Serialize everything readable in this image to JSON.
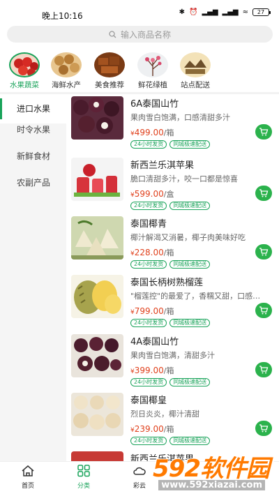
{
  "status_bar": {
    "time": "晚上10:16",
    "battery": "27"
  },
  "search": {
    "placeholder": "输入商品名称"
  },
  "categories": [
    {
      "label": "水果蔬菜",
      "selected": true
    },
    {
      "label": "海鲜水产",
      "selected": false
    },
    {
      "label": "美食推荐",
      "selected": false
    },
    {
      "label": "鲜花绿植",
      "selected": false
    },
    {
      "label": "站点配送",
      "selected": false
    }
  ],
  "sidebar": {
    "items": [
      {
        "label": "进口水果",
        "active": true
      },
      {
        "label": "时令水果",
        "active": false
      },
      {
        "label": "新鲜食材",
        "active": false
      },
      {
        "label": "农副产品",
        "active": false
      }
    ]
  },
  "products": [
    {
      "name": "6A泰国山竹",
      "desc": "果肉雪白饱满，口感清甜多汁",
      "currency": "¥",
      "price": "499.00",
      "unit": "/箱",
      "tags": [
        "24小时发货",
        "同城极速配送"
      ]
    },
    {
      "name": "新西兰乐淇苹果",
      "desc": "脆口清甜多汁，咬一口都是惊喜",
      "currency": "¥",
      "price": "599.00",
      "unit": "/盒",
      "tags": [
        "24小时发货",
        "同城极速配送"
      ]
    },
    {
      "name": "泰国椰青",
      "desc": "椰汁解渴又消暑，椰子肉美味好吃",
      "currency": "¥",
      "price": "228.00",
      "unit": "/箱",
      "tags": [
        "24小时发货",
        "同城极速配送"
      ]
    },
    {
      "name": "泰国长柄树熟榴莲",
      "desc": "\"榴莲控\"的最爱了，香糯又甜，口感特...",
      "currency": "¥",
      "price": "799.00",
      "unit": "/箱",
      "tags": [
        "24小时发货",
        "同城极速配送"
      ]
    },
    {
      "name": "4A泰国山竹",
      "desc": "果肉雪白饱满，清甜多汁",
      "currency": "¥",
      "price": "399.00",
      "unit": "/箱",
      "tags": [
        "24小时发货",
        "同城极速配送"
      ]
    },
    {
      "name": "泰国椰皇",
      "desc": "烈日炎炎，椰汁清甜",
      "currency": "¥",
      "price": "239.00",
      "unit": "/箱",
      "tags": [
        "24小时发货",
        "同城极速配送"
      ]
    },
    {
      "name": "新西兰乐淇苹果",
      "desc": "",
      "currency": "",
      "price": "",
      "unit": "",
      "tags": []
    }
  ],
  "bottom_nav": [
    {
      "label": "首页",
      "icon": "home-icon",
      "active": false
    },
    {
      "label": "分类",
      "icon": "grid-icon",
      "active": true
    },
    {
      "label": "彩云",
      "icon": "cloud-icon",
      "active": false
    }
  ],
  "watermark": {
    "big": "592软件园",
    "url": "www.592xiazai.com"
  },
  "colors": {
    "accent": "#19a35a",
    "price": "#e0401c",
    "cart": "#2bb24c"
  }
}
